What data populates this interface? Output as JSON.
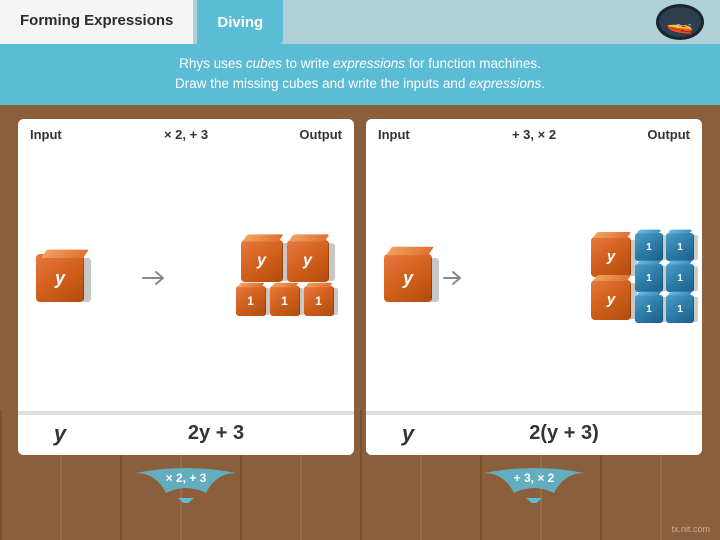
{
  "header": {
    "tab_forming": "Forming Expressions",
    "tab_diving": "Diving",
    "submarine_icon": "🚢"
  },
  "instruction": {
    "line1": "Rhys uses cubes to write expressions for function machines.",
    "line2": "Draw the missing cubes and write the inputs and expressions."
  },
  "machine1": {
    "input_label": "Input",
    "operation": "× 2, + 3",
    "output_label": "Output",
    "input_var": "y",
    "output_expr": "2y + 3",
    "bottom_op": "× 2, + 3"
  },
  "machine2": {
    "input_label": "Input",
    "operation": "+ 3, × 2",
    "output_label": "Output",
    "input_var": "y",
    "output_expr": "2(y + 3)",
    "bottom_op": "+ 3, × 2"
  },
  "watermark": "tx.nit.com"
}
